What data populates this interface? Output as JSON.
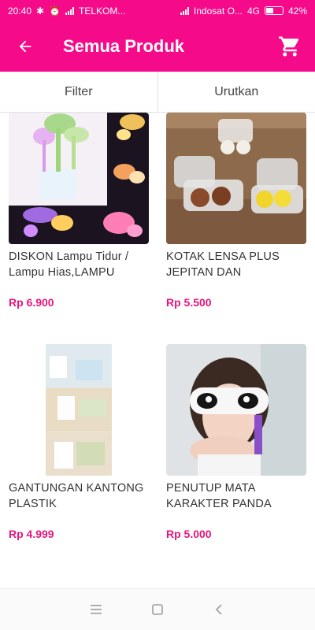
{
  "status": {
    "time": "20:40",
    "carrier1": "TELKOM...",
    "carrier2": "Indosat O...",
    "network": "4G",
    "battery": "42%"
  },
  "appbar": {
    "title": "Semua Produk",
    "back_icon": "arrow-left-icon",
    "cart_icon": "cart-icon"
  },
  "tabs": {
    "filter": "Filter",
    "sort": "Urutkan"
  },
  "products": [
    {
      "name": "DISKON Lampu Tidur / Lampu Hias,LAMPU",
      "price": "Rp 6.900"
    },
    {
      "name": "KOTAK LENSA PLUS JEPITAN DAN",
      "price": "Rp 5.500"
    },
    {
      "name": "GANTUNGAN KANTONG PLASTIK",
      "price": "Rp 4.999"
    },
    {
      "name": "PENUTUP MATA KARAKTER PANDA",
      "price": "Rp 5.000"
    }
  ],
  "colors": {
    "brand": "#f50a8a",
    "price": "#e6157c"
  }
}
